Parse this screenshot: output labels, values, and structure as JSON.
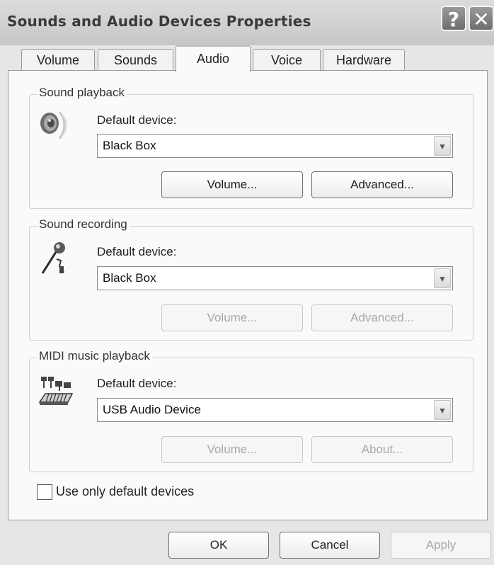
{
  "window": {
    "title": "Sounds and Audio Devices Properties",
    "help_glyph": "?",
    "close_glyph": "✕"
  },
  "tabs": [
    {
      "label": "Volume",
      "active": false
    },
    {
      "label": "Sounds",
      "active": false
    },
    {
      "label": "Audio",
      "active": true
    },
    {
      "label": "Voice",
      "active": false
    },
    {
      "label": "Hardware",
      "active": false
    }
  ],
  "sound_playback": {
    "legend": "Sound playback",
    "icon": "speaker-icon",
    "device_label": "Default device:",
    "device_value": "Black Box",
    "volume_button": "Volume...",
    "advanced_button": "Advanced..."
  },
  "sound_recording": {
    "legend": "Sound recording",
    "icon": "microphone-icon",
    "device_label": "Default device:",
    "device_value": "Black Box",
    "volume_button": "Volume...",
    "advanced_button": "Advanced..."
  },
  "midi_playback": {
    "legend": "MIDI music playback",
    "icon": "midi-keyboard-icon",
    "device_label": "Default device:",
    "device_value": "USB Audio Device",
    "volume_button": "Volume...",
    "about_button": "About..."
  },
  "use_default_only": {
    "label": "Use only default devices",
    "checked": false
  },
  "footer": {
    "ok": "OK",
    "cancel": "Cancel",
    "apply": "Apply"
  }
}
